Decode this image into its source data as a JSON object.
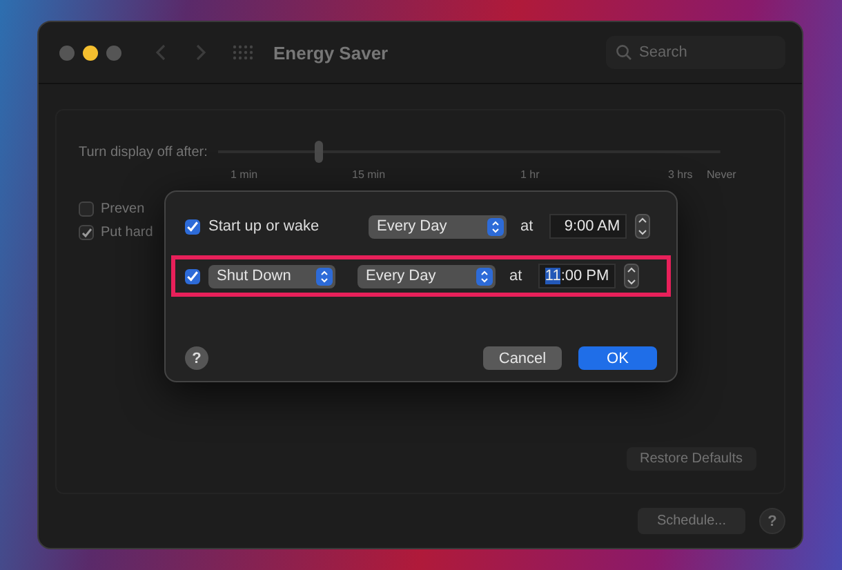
{
  "window": {
    "title": "Energy Saver",
    "search": {
      "placeholder": "Search"
    }
  },
  "display_slider": {
    "label": "Turn display off after:",
    "level": 0.2,
    "ticks": [
      "1 min",
      "15 min",
      "1 hr",
      "3 hrs",
      "Never"
    ]
  },
  "options": [
    {
      "label": "Preven",
      "checked": false
    },
    {
      "label": "Put hard",
      "checked": true
    }
  ],
  "restore_button": "Restore Defaults",
  "schedule_button": "Schedule...",
  "help_button": "?",
  "schedule_dialog": {
    "rows": [
      {
        "kind": "label",
        "checked": true,
        "event": "Start up or wake",
        "days": "Every Day",
        "at": "at",
        "hour": "9",
        "rest": ":00 AM",
        "hour_selected": false,
        "highlighted": false
      },
      {
        "kind": "popup",
        "checked": true,
        "event": "Shut Down",
        "days": "Every Day",
        "at": "at",
        "hour": "11",
        "rest": ":00 PM",
        "hour_selected": true,
        "highlighted": true
      }
    ],
    "help": "?",
    "cancel": "Cancel",
    "ok": "OK"
  }
}
